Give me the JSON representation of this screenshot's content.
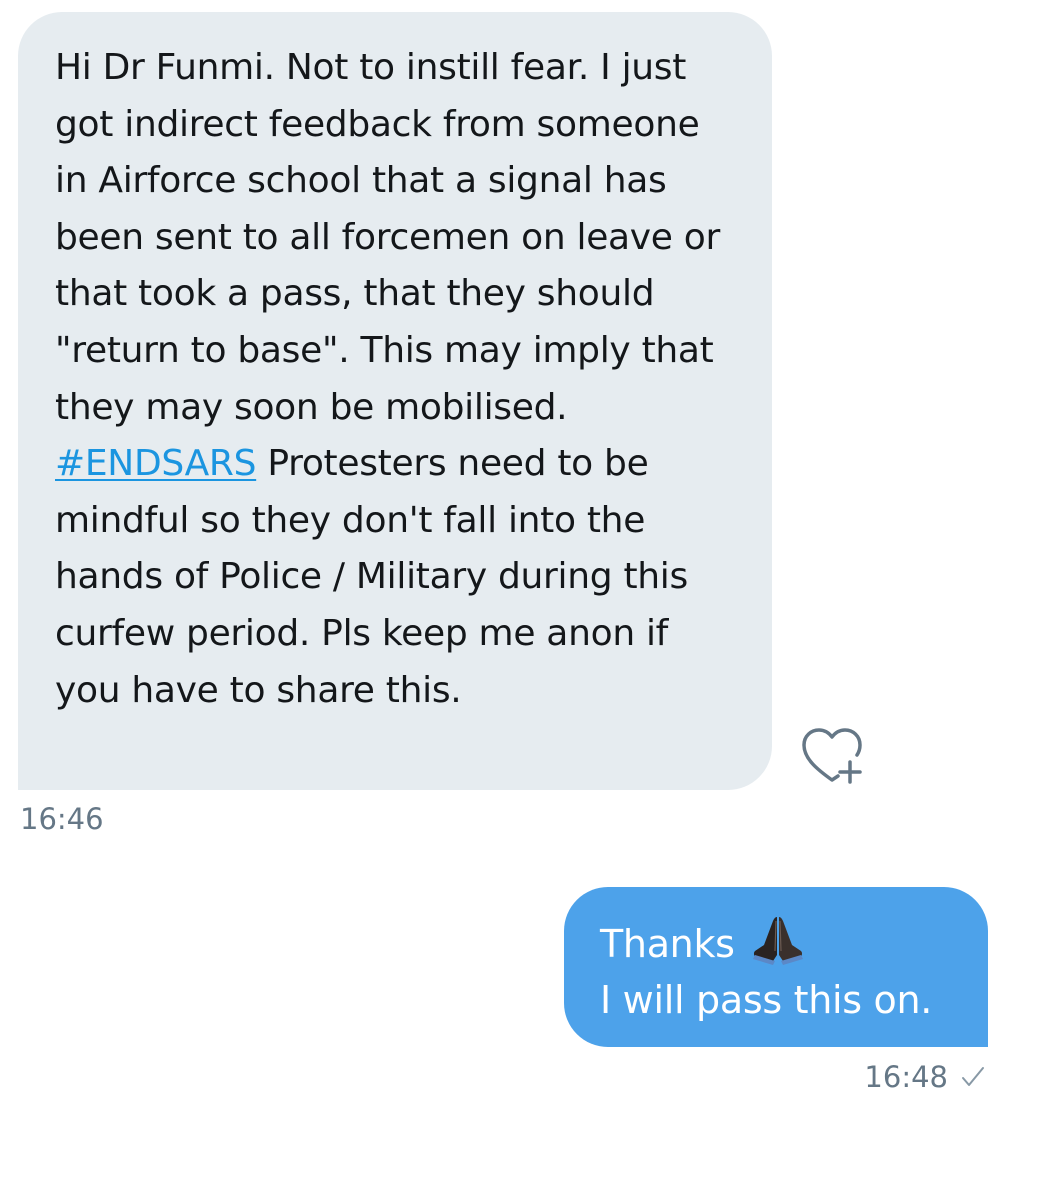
{
  "received_message": {
    "text_before_tag": "Hi Dr Funmi. Not to instill fear. I just got indirect feedback from someone in Airforce school that a signal has been sent to all forcemen on leave or that took a pass, that they should \"return to base\". This may imply that they may soon be mobilised.",
    "hashtag": "#ENDSARS",
    "text_after_tag": " Protesters need to be mindful so they don't fall into the hands of Police / Military during this curfew period. Pls keep me anon if you have to share this.",
    "time": "16:46",
    "like_icon": "heart-plus-icon",
    "bubble_color": "#e6ecf0",
    "hashtag_color": "#1b95e0"
  },
  "sent_message": {
    "line1": "Thanks",
    "emoji": "folded-hands-emoji",
    "line2": "I will pass this on.",
    "time": "16:48",
    "status_icon": "check-icon",
    "bubble_color": "#4da2ea"
  }
}
